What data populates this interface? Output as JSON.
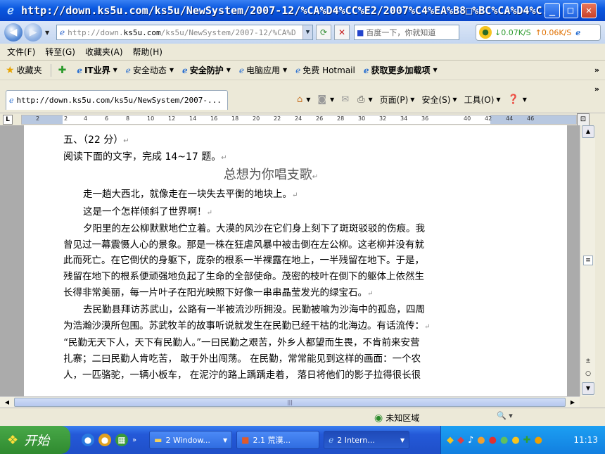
{
  "window": {
    "title": "http://down.ks5u.com/ks5u/NewSystem/2007-12/%CA%D4%CC%E2/2007%C4%EA%B8□%BC%CA%D4%C..."
  },
  "navbar": {
    "back_icon": "back-arrow",
    "forward_icon": "forward-arrow",
    "address_prefix": "http://down.",
    "address_domain": "ks5u.com",
    "address_rest": "/ks5u/NewSystem/2007-12/%CA%D",
    "search_placeholder": "百度一下，你就知道",
    "speed_down": "↓0.07K/S",
    "speed_up": "↑0.06K/S"
  },
  "menu": [
    "文件(F)",
    "转至(G)",
    "收藏夹(A)",
    "帮助(H)"
  ],
  "favorites": {
    "label": "收藏夹",
    "items": [
      {
        "label": "IT业界",
        "bold": true,
        "dropdown": true
      },
      {
        "label": "安全动态",
        "bold": false,
        "dropdown": true
      },
      {
        "label": "安全防护",
        "bold": true,
        "dropdown": true
      },
      {
        "label": "电脑应用",
        "bold": false,
        "dropdown": true
      },
      {
        "label": "免费 Hotmail",
        "bold": false,
        "dropdown": false
      },
      {
        "label": "获取更多加载项",
        "bold": true,
        "dropdown": true
      }
    ]
  },
  "tab": {
    "label": "http://down.ks5u.com/ks5u/NewSystem/2007-..."
  },
  "commands": {
    "page": "页面(P)",
    "safety": "安全(S)",
    "tools": "工具(O)"
  },
  "ruler": {
    "ticks": [
      "2",
      "2",
      "4",
      "6",
      "8",
      "10",
      "12",
      "14",
      "16",
      "18",
      "20",
      "22",
      "24",
      "26",
      "28",
      "30",
      "32",
      "34",
      "36",
      "40",
      "42",
      "44",
      "46"
    ]
  },
  "document": {
    "section": "五、（22 分）",
    "instruction": "阅读下面的文字，完成 14~17 题。",
    "title": "总想为你唱支歌",
    "paragraphs": [
      "走一趟大西北，就像走在一块失去平衡的地块上。",
      "这是一个怎样倾斜了世界啊！",
      "夕阳里的左公柳默默地伫立着。大漠的风沙在它们身上刻下了斑斑驳驳的伤痕。我",
      "曾见过一幕震慑人心的景象。那是一株在狂虐风暴中被击倒在左公柳。这老柳并没有就",
      "此而死亡。在它倒伏的身躯下，庞杂的根系一半裸露在地上，一半残留在地下。于是，",
      "残留在地下的根系便顽强地负起了生命的全部使命。茂密的枝叶在倒下的躯体上依然生",
      "长得非常美丽，每一片叶子在阳光映照下好像一串串晶莹发光的绿宝石。",
      "去民勤县拜访苏武山，公路有一半被流沙所拥没。民勤被喻为沙海中的孤岛，四周",
      "为浩瀚沙漠所包围。苏武牧羊的故事听说就发生在民勤已经干枯的北海边。有话流传：",
      "“民勤无天下人，天下有民勤人。”一曰民勤之艰苦，外乡人都望而生畏，不肯前来安营",
      "扎寨；二曰民勤人肯吃苦，  敢于外出闯荡。  在民勤，常常能见到这样的画面：一个农",
      "人，一匹骆驼，一辆小板车，  在泥泞的路上踽踽走着，  落日将他们的影子拉得很长很"
    ]
  },
  "statusbar": {
    "zone": "未知区域",
    "zoom": "▾"
  },
  "taskbar": {
    "start": "开始",
    "tasks": [
      {
        "label": "2 Window...",
        "icon": "folder"
      },
      {
        "label": "2.1 荒漠...",
        "icon": "powerpoint"
      },
      {
        "label": "2 Intern...",
        "icon": "ie"
      }
    ],
    "clock": "11:13"
  }
}
